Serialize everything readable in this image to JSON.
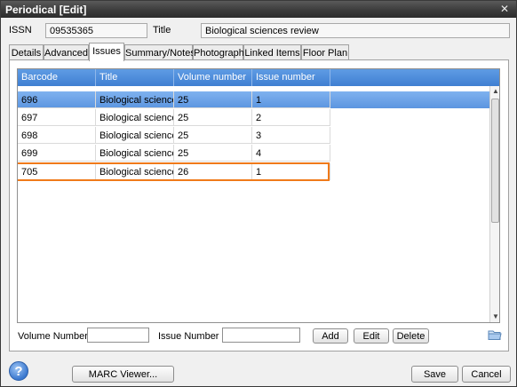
{
  "window": {
    "title": "Periodical [Edit]",
    "close_glyph": "✕"
  },
  "header": {
    "issn_label": "ISSN",
    "issn_value": "09535365",
    "title_label": "Title",
    "title_value": "Biological sciences review"
  },
  "tabs": [
    {
      "label": "Details"
    },
    {
      "label": "Advanced"
    },
    {
      "label": "Issues",
      "active": true
    },
    {
      "label": "Summary/Notes"
    },
    {
      "label": "Photograph"
    },
    {
      "label": "Linked Items"
    },
    {
      "label": "Floor Plan"
    }
  ],
  "grid": {
    "columns": [
      "Barcode",
      "Title",
      "Volume number",
      "Issue number"
    ],
    "rows": [
      {
        "barcode": "696",
        "title": "Biological sciences rev",
        "volume": "25",
        "issue": "1",
        "selected": true
      },
      {
        "barcode": "697",
        "title": "Biological sciences rev",
        "volume": "25",
        "issue": "2"
      },
      {
        "barcode": "698",
        "title": "Biological sciences rev",
        "volume": "25",
        "issue": "3"
      },
      {
        "barcode": "699",
        "title": "Biological sciences rev",
        "volume": "25",
        "issue": "4"
      },
      {
        "barcode": "705",
        "title": "Biological sciences rev",
        "volume": "26",
        "issue": "1",
        "highlighted": true
      }
    ]
  },
  "editor": {
    "volume_label": "Volume Number",
    "volume_value": "",
    "issue_label": "Issue Number",
    "issue_value": "",
    "add_label": "Add",
    "edit_label": "Edit",
    "delete_label": "Delete"
  },
  "footer": {
    "help_glyph": "?",
    "marc_label": "MARC Viewer...",
    "save_label": "Save",
    "cancel_label": "Cancel"
  },
  "icons": {
    "close": "close-icon",
    "help": "help-icon",
    "folder": "folder-icon",
    "scroll_up": "scroll-up-icon",
    "scroll_down": "scroll-down-icon"
  },
  "colors": {
    "titlebar": "#3c3c3c",
    "grid_header": "#4a8ad8",
    "selected_row": "#6fa4e8",
    "highlight_outline": "#f07a1a"
  }
}
